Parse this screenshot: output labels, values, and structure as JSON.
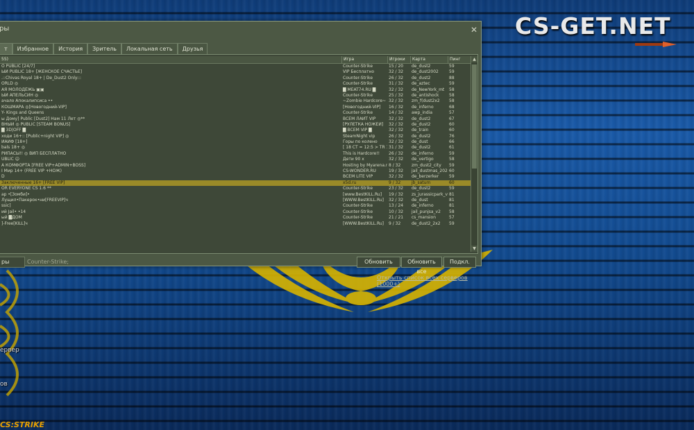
{
  "brand": {
    "logo_text": "CS-GET.NET",
    "cs_logo": "CS:STRIKE"
  },
  "side_labels": {
    "label1": "ервер",
    "label2": "ов"
  },
  "window": {
    "title": "ры",
    "tabs": [
      {
        "label": "т",
        "active": true
      },
      {
        "label": "Избранное"
      },
      {
        "label": "История"
      },
      {
        "label": "Зритель"
      },
      {
        "label": "Локальная сеть"
      },
      {
        "label": "Друзья"
      }
    ],
    "columns": {
      "name": "55)",
      "game": "Игра",
      "players": "Игроки",
      "map": "Карта",
      "ping": "Пинг"
    },
    "servers": [
      {
        "name": "О PUBLIC [24/7]",
        "game": "Counter-Strike",
        "players": "15 / 20",
        "map": "de_dust2",
        "ping": "59"
      },
      {
        "name": "ЫЙ PUBLIC 18+ [ЖЕНСКОЕ СЧАСТЬЕ]",
        "game": "VIP Бесплатно",
        "players": "32 / 32",
        "map": "de_dust2002",
        "ping": "59"
      },
      {
        "name": ".::Chivas Royal 18+ | De_Dust2 Only:::",
        "game": "Counter-Strike",
        "players": "26 / 32",
        "map": "de_dust2",
        "ping": "88"
      },
      {
        "name": "ORLD ◎",
        "game": "Counter-Strike",
        "players": "31 / 32",
        "map": "de_aztec",
        "ping": "59"
      },
      {
        "name": "АЯ МОЛОДЁЖЬ ▣▣",
        "game": "█ MEAT74.RU █",
        "players": "32 / 32",
        "map": "de_NewYork_mt",
        "ping": "58"
      },
      {
        "name": "ЫЙ АПЕЛЬСИН ◎",
        "game": "Counter-Strike",
        "players": "25 / 32",
        "map": "de_antishock",
        "ping": "58"
      },
      {
        "name": "ачало Апокалипсиса ••",
        "game": "~Zombie Hardcore~",
        "players": "32 / 32",
        "map": "zm_f(dust2x2",
        "ping": "58"
      },
      {
        "name": "КОШМАРА ◎[Новогодний-VIP]",
        "game": "[Новогодний-VIP]",
        "players": "16 / 32",
        "map": "de_inferno",
        "ping": "68"
      },
      {
        "name": "Y- Kings and Queens",
        "game": "Counter-Strike",
        "players": "14 / 32",
        "map": "awp_india",
        "ping": "57"
      },
      {
        "name": "ы Дому] Public [Dust2] Нам 11 Лет ◎**",
        "game": "ВСЕМ ЛАЙТ VIP",
        "players": "32 / 32",
        "map": "de_dust2",
        "ping": "67"
      },
      {
        "name": "ВНЫЙ ◎ PUBLIC [STEAM BONUS]",
        "game": "[РУЛЕТКА НОЖЕЙ]",
        "players": "32 / 32",
        "map": "de_dust2",
        "ping": "60"
      },
      {
        "name": "█ 3D|OFF █",
        "game": "█ ВСЕМ VIP █",
        "players": "32 / 32",
        "map": "de_train",
        "ping": "60"
      },
      {
        "name": "ходи 16+:: [Public+night VIP] ◎",
        "game": "SteamNight vip",
        "players": "26 / 32",
        "map": "de_dust2",
        "ping": "76"
      },
      {
        "name": "ЙАЙФ [18+]",
        "game": "Горы по колено",
        "players": "32 / 32",
        "map": "de_dust",
        "ping": "66"
      },
      {
        "name": "bals 18+ ◎",
        "game": "[ 18 CT = 12:5 > TR 13 ]",
        "players": "31 / 32",
        "map": "de_dust2",
        "ping": "61"
      },
      {
        "name": "РИПАСЫ!! ◎ ВИП БЕСПЛАТНО",
        "game": "This is Hardcore!!",
        "players": "26 / 32",
        "map": "de_inferno",
        "ping": "59"
      },
      {
        "name": "UBLIC ☺",
        "game": "Дети 90 х",
        "players": "32 / 32",
        "map": "de_vertigo",
        "ping": "58"
      },
      {
        "name": "А КОМФОРТА [FREE VIP+ADMIN+BOSS]",
        "game": "Hosting by Myarena.ru",
        "players": "8 / 32",
        "map": "zm_dust2_city",
        "ping": "59"
      },
      {
        "name": "I Мир 14+ (FREE VIP +НОЖ)",
        "game": "CS-WONDER.RU",
        "players": "19 / 32",
        "map": "jail_dustmas_202...",
        "ping": "60"
      },
      {
        "name": "D",
        "game": "ВСЕМ LITE VIP",
        "players": "32 / 32",
        "map": "de_berzerker",
        "ping": "59"
      },
      {
        "name": "Заключенные 16+ [FREE VIP]",
        "game": "x5d.ru",
        "players": "9 / 32",
        "map": "jb_saturn",
        "ping": "60",
        "selected": true
      },
      {
        "name": "OR EVERYONE CS 1.6 **",
        "game": "Counter-Strike",
        "players": "23 / 32",
        "map": "de_dust2",
        "ping": "59"
      },
      {
        "name": "ар •[Зомби]•",
        "game": "[www.BestKILL.Ru]",
        "players": "19 / 32",
        "map": "zs_jurassicpark_v2",
        "ping": "81"
      },
      {
        "name": "Лущил•Пакерок•ни[FREEVIP]ч",
        "game": "[WWW.BestKILL.Ru]",
        "players": "32 / 32",
        "map": "de_dust",
        "ping": "81"
      },
      {
        "name": "ssic]",
        "game": "Counter-Strike",
        "players": "13 / 24",
        "map": "de_inferno",
        "ping": "81"
      },
      {
        "name": "ий Jail• •14",
        "game": "Counter-Strike",
        "players": "10 / 32",
        "map": "jail_punjsa_v2",
        "ping": "58"
      },
      {
        "name": "ый █ДОМ",
        "game": "Counter-Strike",
        "players": "21 / 21",
        "map": "cs_mansion",
        "ping": "57"
      },
      {
        "name": "]-Free[KILL]ч",
        "game": "[WWW.BestKILL.Ru]",
        "players": "9 / 32",
        "map": "de_dust2_2x2",
        "ping": "59"
      }
    ],
    "filter_label": "ры",
    "filter_value": "Counter-Strike;",
    "buttons": {
      "refresh": "Обновить",
      "refresh_all": "Обновить все",
      "connect": "Подкл."
    },
    "link": "Открыть список всех серверов (1000+)"
  },
  "colors": {
    "window_bg": "#4c5844",
    "selected_row": "#9a8a28",
    "emblem_gold": "#d8b400",
    "text": "#d6dac6"
  }
}
